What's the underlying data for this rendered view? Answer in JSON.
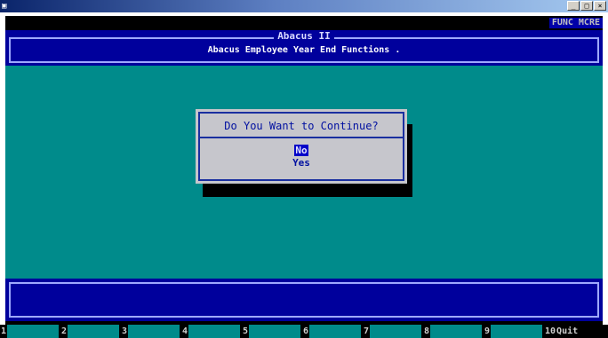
{
  "window": {
    "buttons": [
      "_",
      "□",
      "×"
    ]
  },
  "status": {
    "func_label": "FUNC MCRE"
  },
  "header": {
    "title": "Abacus II",
    "subtitle": "Abacus Employee Year End Functions ."
  },
  "dialog": {
    "question": "Do You Want to Continue?",
    "options": [
      {
        "label": "No",
        "selected": true
      },
      {
        "label": "Yes",
        "selected": false
      }
    ]
  },
  "function_keys": [
    {
      "num": "1",
      "label": ""
    },
    {
      "num": "2",
      "label": ""
    },
    {
      "num": "3",
      "label": ""
    },
    {
      "num": "4",
      "label": ""
    },
    {
      "num": "5",
      "label": ""
    },
    {
      "num": "6",
      "label": ""
    },
    {
      "num": "7",
      "label": ""
    },
    {
      "num": "8",
      "label": ""
    },
    {
      "num": "9",
      "label": ""
    },
    {
      "num": "10",
      "label": "Quit"
    }
  ],
  "colors": {
    "background_teal": "#008b8b",
    "panel_blue": "#00009c",
    "dialog_gray": "#c6c6cc",
    "selection_blue": "#0000c8"
  }
}
